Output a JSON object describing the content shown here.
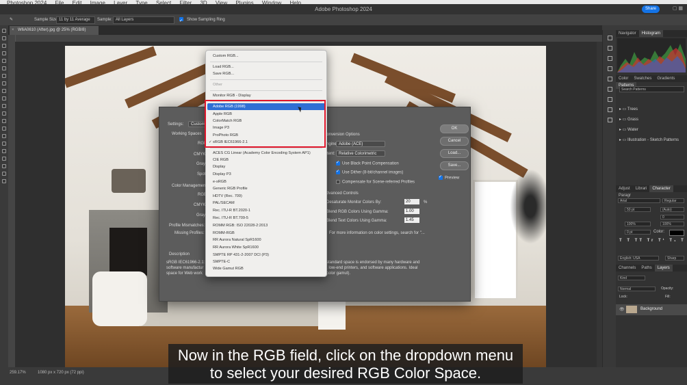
{
  "menubar": {
    "items": [
      "Photoshop 2024",
      "File",
      "Edit",
      "Image",
      "Layer",
      "Type",
      "Select",
      "Filter",
      "3D",
      "View",
      "Plugins",
      "Window",
      "Help"
    ]
  },
  "titlebar": {
    "title": "Adobe Photoshop 2024",
    "share_label": "Share"
  },
  "options_bar": {
    "sample_size_label": "Sample Size:",
    "sample_size_value": "11 by 11 Average",
    "sample_label": "Sample:",
    "sample_value": "All Layers",
    "sampling_ring_label": "Show Sampling Ring"
  },
  "document": {
    "tab_title": "W6A0610 (After).jpg @ 25% (RGB/8)"
  },
  "status": {
    "zoom": "259.17%",
    "doc_size": "1080 px x 720 px (72 ppi)"
  },
  "color_settings": {
    "settings_label": "Settings:",
    "settings_value": "Custom",
    "working_spaces_label": "Working Spaces",
    "rgb_label": "RGB:",
    "cmyk_label": "CMYK:",
    "gray_label": "Gray:",
    "spot_label": "Spot:",
    "color_mgmt_label": "Color Management",
    "cm_rgb_label": "RGB:",
    "cm_cmyk_label": "CMYK:",
    "cm_gray_label": "Gray:",
    "profile_mismatches_label": "Profile Mismatches:",
    "missing_profiles_label": "Missing Profiles:",
    "conversion_title": "Conversion Options",
    "engine_label": "Engine:",
    "engine_value": "Adobe (ACE)",
    "intent_label": "Intent:",
    "intent_value": "Relative Colorimetric",
    "black_point_label": "Use Black Point Compensation",
    "dither_label": "Use Dither (8-bit/channel images)",
    "compensate_label": "Compensate for Scene-referred Profiles",
    "advanced_title": "Advanced Controls",
    "desaturate_label": "Desaturate Monitor Colors By:",
    "desaturate_value": "20",
    "desaturate_unit": "%",
    "blend_rgb_label": "Blend RGB Colors Using Gamma:",
    "blend_rgb_value": "1.00",
    "blend_text_label": "Blend Text Colors Using Gamma:",
    "blend_text_value": "1.45",
    "more_info": "For more information on color settings, search for \"...",
    "description_label": "Description",
    "description_text_1": "sRGB IEC61966-2.1:",
    "description_text_2": "software manufactur",
    "description_text_3": "space for Web work",
    "description_right_1": "standard space is endorsed by many hardware and",
    "description_right_2": ", low-end printers, and software applications.  Ideal",
    "description_right_3": "color gamut).",
    "ok": "OK",
    "cancel": "Cancel",
    "load": "Load...",
    "save": "Save...",
    "preview": "Preview"
  },
  "rgb_menu": {
    "top_items": [
      "Custom RGB...",
      "Load RGB...",
      "Save RGB..."
    ],
    "other_label": "Other",
    "monitor": "Monitor RGB - Display",
    "highlighted": "Adobe RGB (1998)",
    "boxed_items": [
      "Apple RGB",
      "ColorMatch RGB",
      "Image P3",
      "ProPhoto RGB"
    ],
    "checked_item": "sRGB IEC61966-2.1",
    "lower_items": [
      "ACES CG Linear (Academy Color Encoding System AP1)",
      "CIE RGB",
      "Display",
      "Display P3",
      "e-sRGB",
      "Generic RGB Profile",
      "HDTV (Rec. 709)",
      "PAL/SECAM",
      "Rec. ITU-R BT.2020-1",
      "Rec. ITU-R BT.709-5",
      "ROMM RGB: ISO 22028-2:2013",
      "ROMM-RGB",
      "RR Aurora Natural SpR1600",
      "RR Aurora White SpR1600",
      "SMPTE RP 431-2-2007 DCI (P3)",
      "SMPTE-C",
      "Wide Gamut RGB"
    ]
  },
  "right_panel": {
    "top_tabs": [
      "Navigator",
      "Histogram"
    ],
    "swatch_tabs": [
      "Color",
      "Swatches",
      "Gradients",
      "Patterns"
    ],
    "search_placeholder": "Search Patterns",
    "folders": [
      "Trees",
      "Grass",
      "Water",
      "Illustration - Sketch Patterns"
    ],
    "char_tabs": [
      "Adjust",
      "Librari",
      "Character",
      "Paragr"
    ],
    "font_family": "Arial",
    "font_style": "Regular",
    "font_size": "50 pt",
    "leading": "(Auto)",
    "tracking": "0",
    "vscale": "100%",
    "hscale": "100%",
    "baseline": "0 pt",
    "color_label": "Color:",
    "language": "English: USA",
    "aa": "Sharp",
    "layer_tabs": [
      "Channels",
      "Paths",
      "Layers"
    ],
    "layer_kind": "Kind",
    "blend_mode": "Normal",
    "opacity_label": "Opacity:",
    "fill_label": "Fill:",
    "lock_label": "Lock:",
    "layer_name": "Background"
  },
  "subtitles": {
    "line1": "Now in the RGB field, click on the dropdown menu",
    "line2": "to select your desired RGB Color Space."
  }
}
